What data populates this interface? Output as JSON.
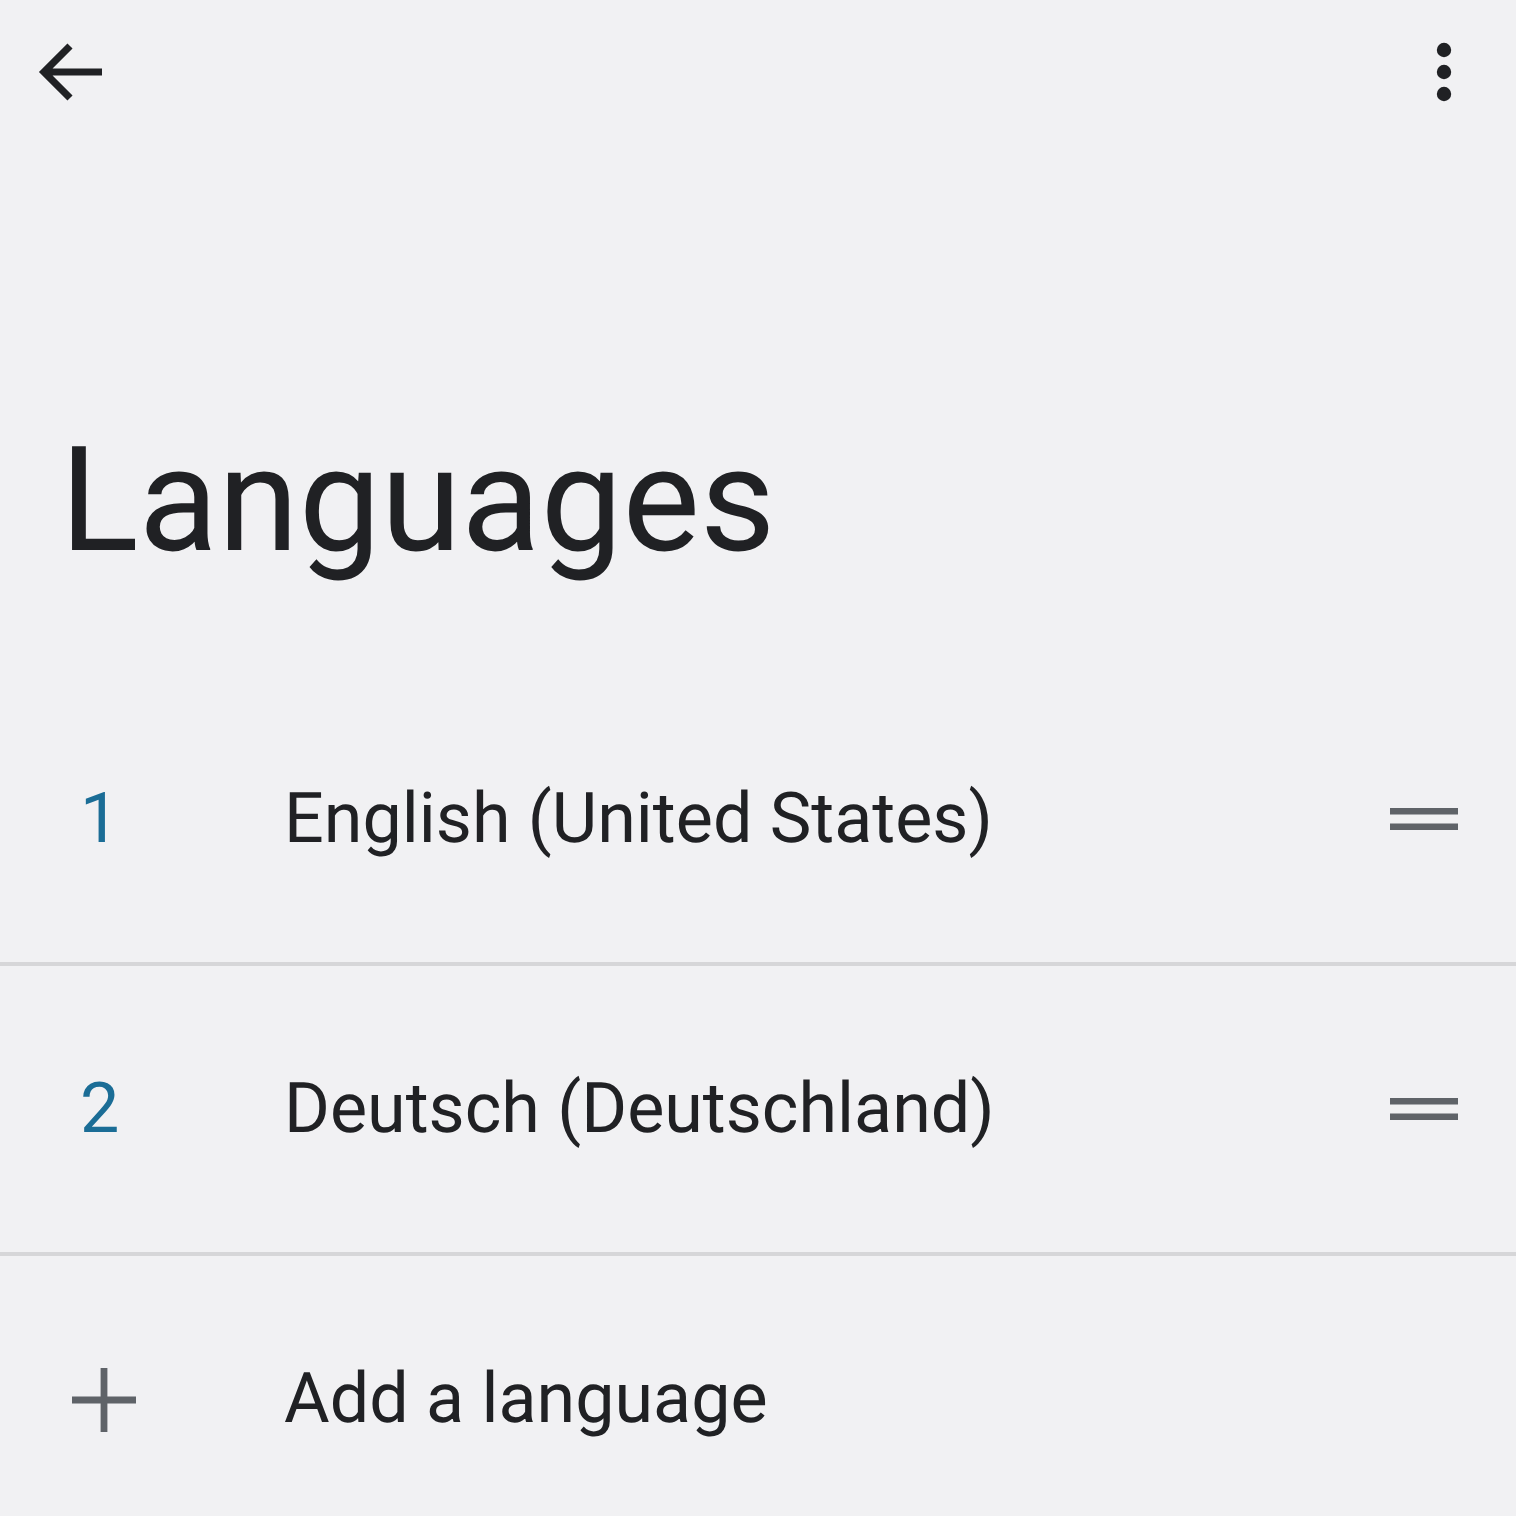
{
  "title": "Languages",
  "items": [
    {
      "kind": "language",
      "number": "1",
      "label": "English (United States)"
    },
    {
      "kind": "language",
      "number": "2",
      "label": "Deutsch (Deutschland)"
    },
    {
      "kind": "add",
      "label": "Add a language"
    }
  ]
}
